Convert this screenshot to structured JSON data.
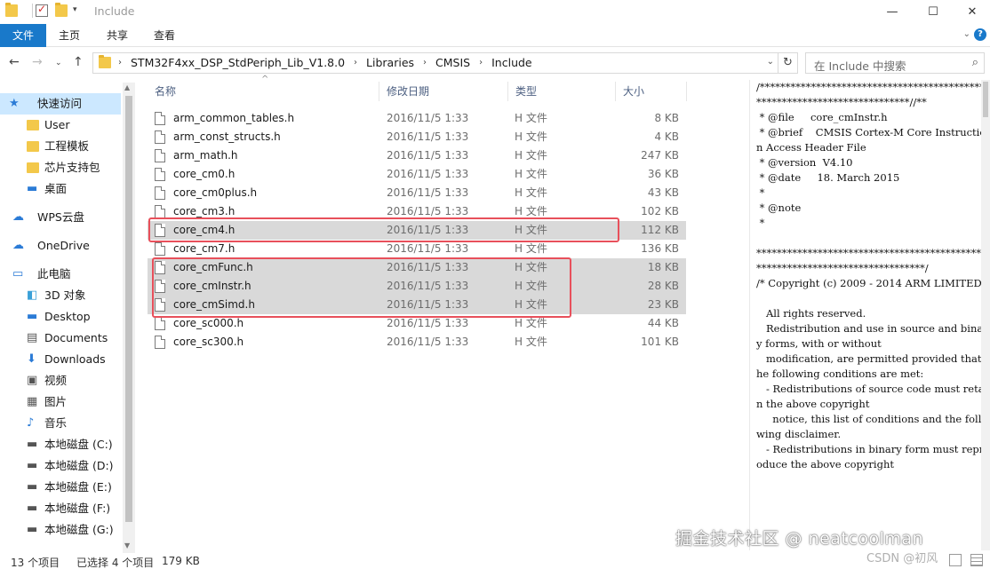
{
  "window": {
    "title": "Include"
  },
  "ribbon": {
    "tabs": [
      "文件",
      "主页",
      "共享",
      "查看"
    ]
  },
  "address": {
    "crumbs": [
      "STM32F4xx_DSP_StdPeriph_Lib_V1.8.0",
      "Libraries",
      "CMSIS",
      "Include"
    ],
    "search_placeholder": "在 Include 中搜索"
  },
  "nav": {
    "items": [
      {
        "label": "快速访问",
        "icon": "star-icon"
      },
      {
        "label": "User",
        "icon": "folder-icon"
      },
      {
        "label": "工程模板",
        "icon": "folder-icon"
      },
      {
        "label": "芯片支持包",
        "icon": "folder-icon"
      },
      {
        "label": "桌面",
        "icon": "desktop-icon"
      },
      {
        "label": "WPS云盘",
        "icon": "cloud-icon"
      },
      {
        "label": "OneDrive",
        "icon": "cloud-icon"
      },
      {
        "label": "此电脑",
        "icon": "computer-icon"
      },
      {
        "label": "3D 对象",
        "icon": "cube-icon"
      },
      {
        "label": "Desktop",
        "icon": "desktop-icon"
      },
      {
        "label": "Documents",
        "icon": "document-icon"
      },
      {
        "label": "Downloads",
        "icon": "download-icon"
      },
      {
        "label": "视频",
        "icon": "video-icon"
      },
      {
        "label": "图片",
        "icon": "picture-icon"
      },
      {
        "label": "音乐",
        "icon": "music-icon"
      },
      {
        "label": "本地磁盘 (C:)",
        "icon": "drive-icon"
      },
      {
        "label": "本地磁盘 (D:)",
        "icon": "drive-icon"
      },
      {
        "label": "本地磁盘 (E:)",
        "icon": "drive-icon"
      },
      {
        "label": "本地磁盘 (F:)",
        "icon": "drive-icon"
      },
      {
        "label": "本地磁盘 (G:)",
        "icon": "drive-icon"
      }
    ]
  },
  "columns": {
    "name": "名称",
    "date": "修改日期",
    "type": "类型",
    "size": "大小"
  },
  "files": [
    {
      "name": "arm_common_tables.h",
      "date": "2016/11/5 1:33",
      "type": "H 文件",
      "size": "8 KB"
    },
    {
      "name": "arm_const_structs.h",
      "date": "2016/11/5 1:33",
      "type": "H 文件",
      "size": "4 KB"
    },
    {
      "name": "arm_math.h",
      "date": "2016/11/5 1:33",
      "type": "H 文件",
      "size": "247 KB"
    },
    {
      "name": "core_cm0.h",
      "date": "2016/11/5 1:33",
      "type": "H 文件",
      "size": "36 KB"
    },
    {
      "name": "core_cm0plus.h",
      "date": "2016/11/5 1:33",
      "type": "H 文件",
      "size": "43 KB"
    },
    {
      "name": "core_cm3.h",
      "date": "2016/11/5 1:33",
      "type": "H 文件",
      "size": "102 KB"
    },
    {
      "name": "core_cm4.h",
      "date": "2016/11/5 1:33",
      "type": "H 文件",
      "size": "112 KB"
    },
    {
      "name": "core_cm7.h",
      "date": "2016/11/5 1:33",
      "type": "H 文件",
      "size": "136 KB"
    },
    {
      "name": "core_cmFunc.h",
      "date": "2016/11/5 1:33",
      "type": "H 文件",
      "size": "18 KB"
    },
    {
      "name": "core_cmInstr.h",
      "date": "2016/11/5 1:33",
      "type": "H 文件",
      "size": "28 KB"
    },
    {
      "name": "core_cmSimd.h",
      "date": "2016/11/5 1:33",
      "type": "H 文件",
      "size": "23 KB"
    },
    {
      "name": "core_sc000.h",
      "date": "2016/11/5 1:33",
      "type": "H 文件",
      "size": "44 KB"
    },
    {
      "name": "core_sc300.h",
      "date": "2016/11/5 1:33",
      "type": "H 文件",
      "size": "101 KB"
    }
  ],
  "preview": {
    "text": "/**************************************************************************//**\n * @file     core_cmInstr.h\n * @brief    CMSIS Cortex-M Core Instruction Access Header File\n * @version  V4.10\n * @date     18. March 2015\n *\n * @note\n *\n\n******************************************************************************/\n/* Copyright (c) 2009 - 2014 ARM LIMITED\n\n   All rights reserved.\n   Redistribution and use in source and binary forms, with or without\n   modification, are permitted provided that the following conditions are met:\n   - Redistributions of source code must retain the above copyright\n     notice, this list of conditions and the following disclaimer.\n   - Redistributions in binary form must reproduce the above copyright"
  },
  "status": {
    "count": "13 个项目",
    "selected": "已选择 4 个项目",
    "size": "179 KB"
  },
  "watermark": {
    "text": "掘金技术社区 @ neatcoolman",
    "sub": "CSDN @初风"
  }
}
